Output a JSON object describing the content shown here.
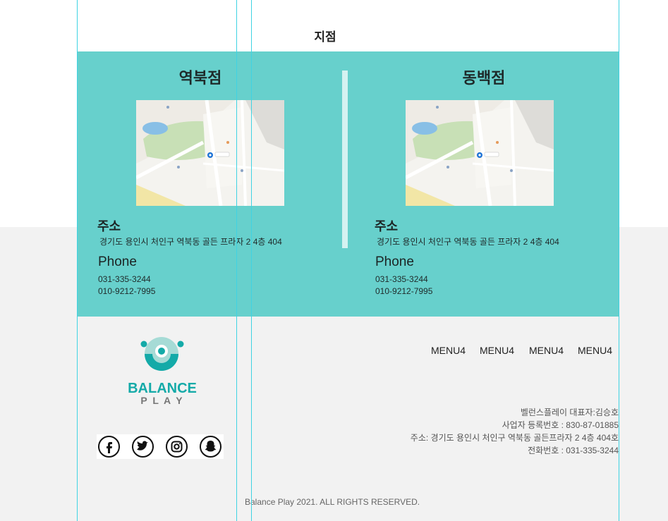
{
  "section": {
    "title": "지점"
  },
  "branches": [
    {
      "name": "역북점",
      "address_heading": "주소",
      "address": "경기도 용인시 처인구 역북동 골든 프라자 2 4층 404",
      "phone_heading": "Phone",
      "phones": [
        "031-335-3244",
        "010-9212-7995"
      ]
    },
    {
      "name": "동백점",
      "address_heading": "주소",
      "address": "경기도 용인시 처인구 역북동 골든 프라자 2 4층 404",
      "phone_heading": "Phone",
      "phones": [
        "031-335-3244",
        "010-9212-7995"
      ]
    }
  ],
  "footer": {
    "logo": {
      "line1": "BALANCE",
      "line2": "P L A Y"
    },
    "social": [
      "facebook-icon",
      "twitter-icon",
      "instagram-icon",
      "snapchat-icon"
    ],
    "menu": [
      "MENU4",
      "MENU4",
      "MENU4",
      "MENU4"
    ],
    "info": [
      "벨런스플레이 대표자:김승호",
      "사업자 등록번호 : 830-87-01885",
      "주소: 경기도 용인시 처인구 역북동 골든프라자 2 4층 404호",
      "전화번호 : 031-335-3244"
    ],
    "copyright": "Balance Play 2021. ALL RIGHTS RESERVED."
  },
  "colors": {
    "teal": "#67d0cc",
    "brand": "#14aaa8",
    "guide": "#3fd3e3",
    "footer_bg": "#f2f2f2"
  }
}
